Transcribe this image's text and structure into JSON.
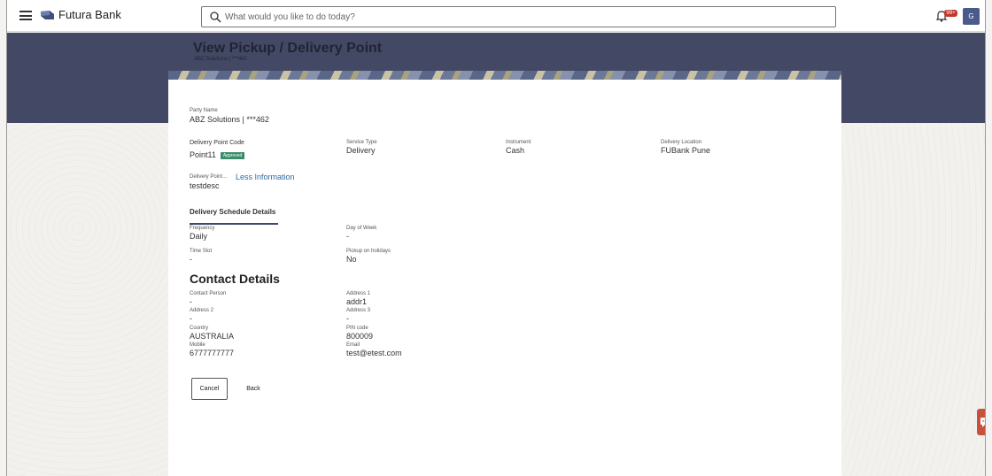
{
  "header": {
    "brand": "Futura Bank",
    "search_placeholder": "What would you like to do today?",
    "notification_badge": "99+",
    "avatar_initial": "G"
  },
  "page": {
    "title": "View Pickup / Delivery Point",
    "subtitle": "ABZ Solutions | ***462"
  },
  "party": {
    "label": "Party Name",
    "value": "ABZ Solutions | ***462"
  },
  "delivery_point": {
    "code_label": "Delivery Point Code",
    "code_value": "Point11",
    "status": "Approved",
    "service_type_label": "Service Type",
    "service_type_value": "Delivery",
    "instrument_label": "Instrument",
    "instrument_value": "Cash",
    "location_label": "Delivery Location",
    "location_value": "FUBank Pune",
    "desc_label": "Delivery Point...",
    "less_info": "Less Information",
    "desc_value": "testdesc"
  },
  "schedule": {
    "heading": "Delivery Schedule Details",
    "frequency_label": "Frequency",
    "frequency_value": "Daily",
    "day_label": "Day of Week",
    "day_value": "-",
    "timeslot_label": "Time Slot",
    "timeslot_value": "-",
    "holidays_label": "Pickup on holidays",
    "holidays_value": "No"
  },
  "contact": {
    "heading": "Contact Details",
    "person_label": "Contact Person",
    "person_value": "-",
    "address1_label": "Address 1",
    "address1_value": "addr1",
    "address2_label": "Address 2",
    "address2_value": "-",
    "address3_label": "Address 3",
    "address3_value": "-",
    "country_label": "Country",
    "country_value": "AUSTRALIA",
    "pin_label": "PIN code",
    "pin_value": "800009",
    "mobile_label": "Mobile",
    "mobile_value": "6777777777",
    "email_label": "Email",
    "email_value": "test@etest.com"
  },
  "actions": {
    "cancel": "Cancel",
    "back": "Back"
  },
  "colors": {
    "header_band": "#434964",
    "status_approved": "#3b8d6a",
    "link": "#2c6aa0",
    "chat": "#c9513c"
  }
}
